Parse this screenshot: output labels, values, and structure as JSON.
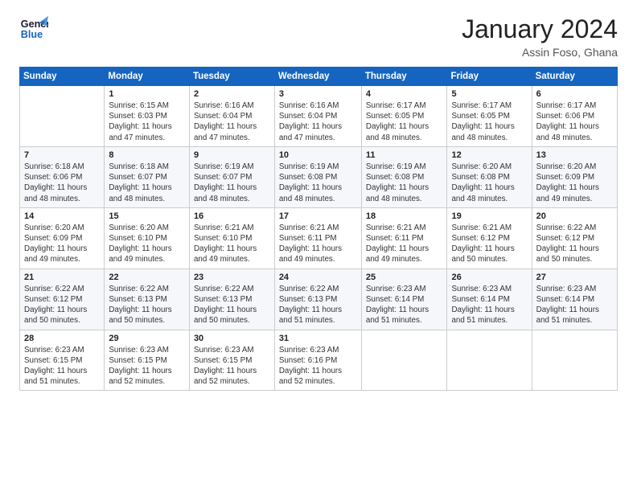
{
  "header": {
    "logo_line1": "General",
    "logo_line2": "Blue",
    "month_year": "January 2024",
    "location": "Assin Foso, Ghana"
  },
  "days_of_week": [
    "Sunday",
    "Monday",
    "Tuesday",
    "Wednesday",
    "Thursday",
    "Friday",
    "Saturday"
  ],
  "weeks": [
    [
      {
        "num": "",
        "info": ""
      },
      {
        "num": "1",
        "info": "Sunrise: 6:15 AM\nSunset: 6:03 PM\nDaylight: 11 hours\nand 47 minutes."
      },
      {
        "num": "2",
        "info": "Sunrise: 6:16 AM\nSunset: 6:04 PM\nDaylight: 11 hours\nand 47 minutes."
      },
      {
        "num": "3",
        "info": "Sunrise: 6:16 AM\nSunset: 6:04 PM\nDaylight: 11 hours\nand 47 minutes."
      },
      {
        "num": "4",
        "info": "Sunrise: 6:17 AM\nSunset: 6:05 PM\nDaylight: 11 hours\nand 48 minutes."
      },
      {
        "num": "5",
        "info": "Sunrise: 6:17 AM\nSunset: 6:05 PM\nDaylight: 11 hours\nand 48 minutes."
      },
      {
        "num": "6",
        "info": "Sunrise: 6:17 AM\nSunset: 6:06 PM\nDaylight: 11 hours\nand 48 minutes."
      }
    ],
    [
      {
        "num": "7",
        "info": "Sunrise: 6:18 AM\nSunset: 6:06 PM\nDaylight: 11 hours\nand 48 minutes."
      },
      {
        "num": "8",
        "info": "Sunrise: 6:18 AM\nSunset: 6:07 PM\nDaylight: 11 hours\nand 48 minutes."
      },
      {
        "num": "9",
        "info": "Sunrise: 6:19 AM\nSunset: 6:07 PM\nDaylight: 11 hours\nand 48 minutes."
      },
      {
        "num": "10",
        "info": "Sunrise: 6:19 AM\nSunset: 6:08 PM\nDaylight: 11 hours\nand 48 minutes."
      },
      {
        "num": "11",
        "info": "Sunrise: 6:19 AM\nSunset: 6:08 PM\nDaylight: 11 hours\nand 48 minutes."
      },
      {
        "num": "12",
        "info": "Sunrise: 6:20 AM\nSunset: 6:08 PM\nDaylight: 11 hours\nand 48 minutes."
      },
      {
        "num": "13",
        "info": "Sunrise: 6:20 AM\nSunset: 6:09 PM\nDaylight: 11 hours\nand 49 minutes."
      }
    ],
    [
      {
        "num": "14",
        "info": "Sunrise: 6:20 AM\nSunset: 6:09 PM\nDaylight: 11 hours\nand 49 minutes."
      },
      {
        "num": "15",
        "info": "Sunrise: 6:20 AM\nSunset: 6:10 PM\nDaylight: 11 hours\nand 49 minutes."
      },
      {
        "num": "16",
        "info": "Sunrise: 6:21 AM\nSunset: 6:10 PM\nDaylight: 11 hours\nand 49 minutes."
      },
      {
        "num": "17",
        "info": "Sunrise: 6:21 AM\nSunset: 6:11 PM\nDaylight: 11 hours\nand 49 minutes."
      },
      {
        "num": "18",
        "info": "Sunrise: 6:21 AM\nSunset: 6:11 PM\nDaylight: 11 hours\nand 49 minutes."
      },
      {
        "num": "19",
        "info": "Sunrise: 6:21 AM\nSunset: 6:12 PM\nDaylight: 11 hours\nand 50 minutes."
      },
      {
        "num": "20",
        "info": "Sunrise: 6:22 AM\nSunset: 6:12 PM\nDaylight: 11 hours\nand 50 minutes."
      }
    ],
    [
      {
        "num": "21",
        "info": "Sunrise: 6:22 AM\nSunset: 6:12 PM\nDaylight: 11 hours\nand 50 minutes."
      },
      {
        "num": "22",
        "info": "Sunrise: 6:22 AM\nSunset: 6:13 PM\nDaylight: 11 hours\nand 50 minutes."
      },
      {
        "num": "23",
        "info": "Sunrise: 6:22 AM\nSunset: 6:13 PM\nDaylight: 11 hours\nand 50 minutes."
      },
      {
        "num": "24",
        "info": "Sunrise: 6:22 AM\nSunset: 6:13 PM\nDaylight: 11 hours\nand 51 minutes."
      },
      {
        "num": "25",
        "info": "Sunrise: 6:23 AM\nSunset: 6:14 PM\nDaylight: 11 hours\nand 51 minutes."
      },
      {
        "num": "26",
        "info": "Sunrise: 6:23 AM\nSunset: 6:14 PM\nDaylight: 11 hours\nand 51 minutes."
      },
      {
        "num": "27",
        "info": "Sunrise: 6:23 AM\nSunset: 6:14 PM\nDaylight: 11 hours\nand 51 minutes."
      }
    ],
    [
      {
        "num": "28",
        "info": "Sunrise: 6:23 AM\nSunset: 6:15 PM\nDaylight: 11 hours\nand 51 minutes."
      },
      {
        "num": "29",
        "info": "Sunrise: 6:23 AM\nSunset: 6:15 PM\nDaylight: 11 hours\nand 52 minutes."
      },
      {
        "num": "30",
        "info": "Sunrise: 6:23 AM\nSunset: 6:15 PM\nDaylight: 11 hours\nand 52 minutes."
      },
      {
        "num": "31",
        "info": "Sunrise: 6:23 AM\nSunset: 6:16 PM\nDaylight: 11 hours\nand 52 minutes."
      },
      {
        "num": "",
        "info": ""
      },
      {
        "num": "",
        "info": ""
      },
      {
        "num": "",
        "info": ""
      }
    ]
  ]
}
